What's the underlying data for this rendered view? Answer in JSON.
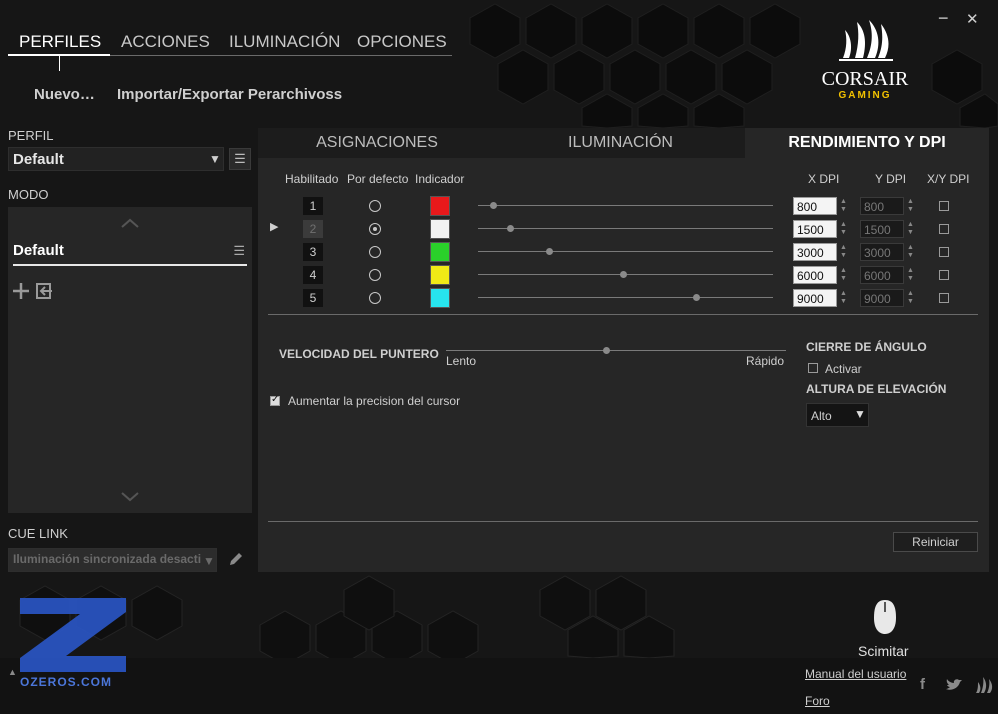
{
  "window": {
    "minimize": "−",
    "close": "✕"
  },
  "topnav": {
    "tabs": [
      "PERFILES",
      "ACCIONES",
      "ILUMINACIÓN",
      "OPCIONES"
    ]
  },
  "actions": {
    "new": "Nuevo…",
    "import_export": "Importar/Exportar Perarchivoss"
  },
  "logo": {
    "brand": "CORSAIR",
    "sub": "GAMING"
  },
  "left": {
    "perfil_label": "PERFIL",
    "perfil_value": "Default",
    "modo_label": "MODO",
    "modo_item": "Default",
    "cue_label": "CUE LINK",
    "cue_value": "Iluminación sincronizada desacti"
  },
  "main": {
    "tabs": [
      "ASIGNACIONES",
      "ILUMINACIÓN",
      "RENDIMIENTO Y DPI"
    ],
    "headers": {
      "enabled": "Habilitado",
      "default": "Por defecto",
      "indicator": "Indicador",
      "x": "X DPI",
      "y": "Y DPI",
      "xy": "X/Y DPI"
    },
    "rows": [
      {
        "num": "1",
        "color": "#e8191b",
        "x": "800",
        "y": "800",
        "slider": 0.05
      },
      {
        "num": "2",
        "color": "#f2f2f2",
        "x": "1500",
        "y": "1500",
        "slider": 0.11
      },
      {
        "num": "3",
        "color": "#2ad02a",
        "x": "3000",
        "y": "3000",
        "slider": 0.24
      },
      {
        "num": "4",
        "color": "#f0ea16",
        "x": "6000",
        "y": "6000",
        "slider": 0.49
      },
      {
        "num": "5",
        "color": "#27e4ee",
        "x": "9000",
        "y": "9000",
        "slider": 0.74
      }
    ],
    "pointer": {
      "label": "VELOCIDAD DEL PUNTERO",
      "slow": "Lento",
      "fast": "Rápido",
      "value": 0.47,
      "enhance": "Aumentar la precision del cursor"
    },
    "angle": {
      "label": "CIERRE DE ÁNGULO",
      "activate": "Activar"
    },
    "lift": {
      "label": "ALTURA DE ELEVACIÓN",
      "value": "Alto"
    },
    "reset": "Reiniciar"
  },
  "device": {
    "name": "Scimitar"
  },
  "footer": {
    "manual": "Manual del usuario",
    "forum": "Foro",
    "watermark_site": "OZEROS.COM",
    "watermark_letter": "Z"
  },
  "colors": {
    "accent": "#f2c200",
    "panel": "#262626"
  }
}
